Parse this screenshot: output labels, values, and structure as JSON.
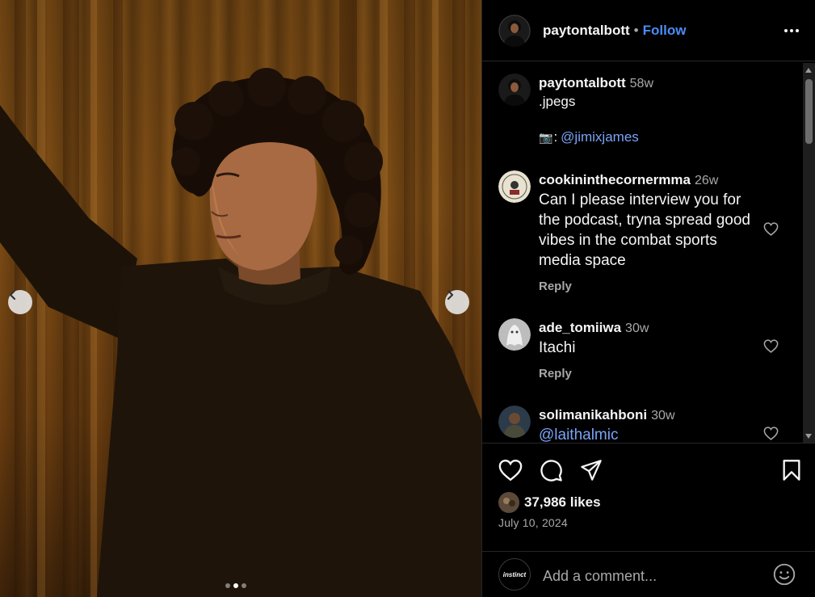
{
  "post": {
    "username": "paytontalbott",
    "separator": "•",
    "follow_label": "Follow",
    "more_icon": "more-horizontal-icon",
    "carousel": {
      "total": 3,
      "active_index": 1
    }
  },
  "caption": {
    "username": "paytontalbott",
    "time": "58w",
    "line1": ".jpegs",
    "camera_icon": "📷",
    "colon": ":",
    "mention": "@jimixjames"
  },
  "comments": [
    {
      "username": "cookininthecornermma",
      "time": "26w",
      "lines": [
        "Can I please interview you for",
        "the podcast, tryna spread good",
        "vibes in the combat sports",
        "media space"
      ],
      "reply_label": "Reply"
    },
    {
      "username": "ade_tomiiwa",
      "time": "30w",
      "text": "Itachi",
      "reply_label": "Reply"
    },
    {
      "username": "solimanikahboni",
      "time": "30w",
      "text": "@laithalmic"
    }
  ],
  "actions": {
    "likes": "37,986 likes",
    "date": "July 10, 2024"
  },
  "add_comment": {
    "avatar_text": "instinct",
    "placeholder": "Add a comment..."
  },
  "colors": {
    "accent": "#4a8cf7",
    "mention": "#7aa3f5",
    "muted": "#a8a8a8",
    "background": "#000000"
  }
}
